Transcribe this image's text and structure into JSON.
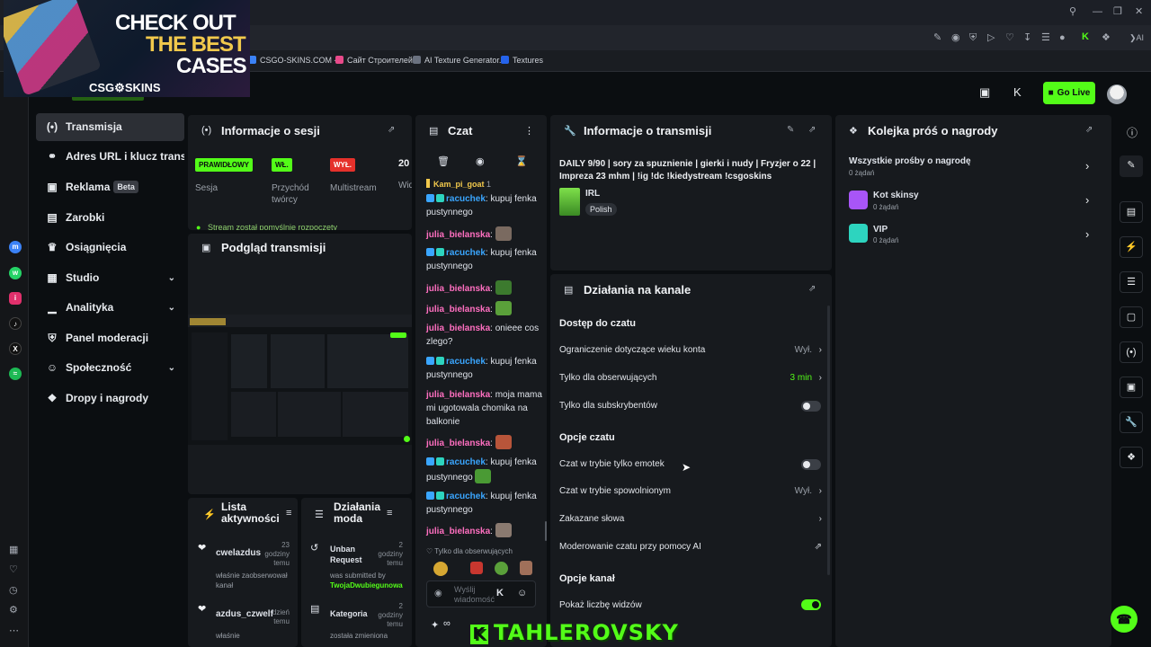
{
  "ad": {
    "line1": "CHECK OUT",
    "line2": "THE BEST",
    "line3": "CASES",
    "brand": "CSG⚙SKINS"
  },
  "bookmarks": [
    "CSGO-SKINS.COM -...",
    "Сайт Строителей",
    "AI Texture Generator...",
    "Textures"
  ],
  "browser": {
    "ai_label": "AI"
  },
  "header": {
    "go_live": "Go Live"
  },
  "nav": [
    {
      "label": "Transmisja",
      "icon": "(•)"
    },
    {
      "label": "Adres URL i klucz transmisji",
      "icon": "⚭"
    },
    {
      "label": "Reklama",
      "icon": "▣",
      "badge": "Beta"
    },
    {
      "label": "Zarobki",
      "icon": "▤"
    },
    {
      "label": "Osiągnięcia",
      "icon": "♛"
    },
    {
      "label": "Studio",
      "icon": "▦"
    },
    {
      "label": "Analityka",
      "icon": "▁"
    },
    {
      "label": "Panel moderacji",
      "icon": "⛨"
    },
    {
      "label": "Społeczność",
      "icon": "☺"
    },
    {
      "label": "Dropy i nagrody",
      "icon": "❖"
    }
  ],
  "session": {
    "title": "Informacje o sesji",
    "stats": [
      {
        "tag": "PRAWIDŁOWY",
        "label": "Sesja",
        "color": "#53fc18"
      },
      {
        "tag": "WŁ.",
        "label": "Przychód twórcy",
        "color": "#53fc18"
      },
      {
        "tag": "WYŁ.",
        "label": "Multistream",
        "color": "#e5312b"
      },
      {
        "tag": "20",
        "label": "Wid"
      }
    ],
    "notice": "Stream został pomyślnie rozpoczęty"
  },
  "preview": {
    "title": "Podgląd transmisji"
  },
  "activity": {
    "title": "Lista aktywności",
    "items": [
      {
        "user": "cwelazdus",
        "time": "23 godziny temu",
        "text": "właśnie zaobserwował kanał"
      },
      {
        "user": "azdus_czwelf",
        "time": "dzień temu",
        "text": "właśnie"
      }
    ]
  },
  "modactions": {
    "title": "Działania moda",
    "items": [
      {
        "title": "Unban Request",
        "time": "2 godziny temu",
        "text": "was submitted by",
        "user": "TwojaDwubiegunowa"
      },
      {
        "title": "Kategoria",
        "time": "2 godziny temu",
        "text": "została zmieniona"
      }
    ]
  },
  "chat": {
    "title": "Czat",
    "pinned": {
      "user": "Kam_pi_goat",
      "count": "1"
    },
    "messages": [
      {
        "user": "racuchek",
        "text": ": kupuj fenka pustynnego",
        "color": "#3aa6ff",
        "badges": true
      },
      {
        "user": "julia_bielanska",
        "text": ":",
        "color": "#ff6fc0",
        "emote": "#7a6a60"
      },
      {
        "user": "racuchek",
        "text": ": kupuj fenka pustynnego",
        "color": "#3aa6ff",
        "badges": true
      },
      {
        "user": "julia_bielanska",
        "text": ":",
        "color": "#ff6fc0",
        "emote": "#3c7a2e"
      },
      {
        "user": "julia_bielanska",
        "text": ":",
        "color": "#ff6fc0",
        "emote": "#5aa03a"
      },
      {
        "user": "julia_bielanska",
        "text": ": onieee cos zlego?",
        "color": "#ff6fc0"
      },
      {
        "user": "racuchek",
        "text": ": kupuj fenka pustynnego",
        "color": "#3aa6ff",
        "badges": true
      },
      {
        "user": "julia_bielanska",
        "text": ": moja mama mi ugotowala chomika na balkonie",
        "color": "#ff6fc0"
      },
      {
        "user": "julia_bielanska",
        "text": ":",
        "color": "#ff6fc0",
        "emote": "#b8553a"
      },
      {
        "user": "racuchek",
        "text": ": kupuj fenka pustynnego",
        "color": "#3aa6ff",
        "badges": true,
        "emote_after": "#4a9a34"
      },
      {
        "user": "racuchek",
        "text": ": kupuj fenka pustynnego",
        "color": "#3aa6ff",
        "badges": true
      },
      {
        "user": "julia_bielanska",
        "text": ":",
        "color": "#ff6fc0",
        "emote": "#8a7a70"
      }
    ],
    "followers_only": "Tylko dla obserwujących",
    "input_placeholder": "Wyślij wiadomość"
  },
  "stream_info": {
    "title": "Informacje o transmisji",
    "stream_title": "DAILY 9/90 | sory za spuznienie | gierki i nudy | Fryzjer o 22 | Impreza 23 mhm | !ig !dc !kiedystream !csgoskins",
    "category": "IRL",
    "language": "Polish"
  },
  "channel": {
    "title": "Działania na kanale",
    "chat_access": "Dostęp do czatu",
    "rows1": [
      {
        "label": "Ograniczenie dotyczące wieku konta",
        "value": "Wył."
      },
      {
        "label": "Tylko dla obserwujących",
        "value": "3 min"
      },
      {
        "label": "Tylko dla subskrybentów",
        "toggle": false
      }
    ],
    "chat_options": "Opcje czatu",
    "rows2": [
      {
        "label": "Czat w trybie tylko emotek",
        "toggle": false
      },
      {
        "label": "Czat w trybie spowolnionym",
        "value": "Wył."
      },
      {
        "label": "Zakazane słowa"
      },
      {
        "label": "Moderowanie czatu przy pomocy AI"
      }
    ],
    "channel_options": "Opcje kanał",
    "rows3": [
      {
        "label": "Pokaż liczbę widzów",
        "toggle": true
      }
    ]
  },
  "rewards": {
    "title": "Kolejka próś o nagrody",
    "all": "Wszystkie prośby o nagrodę",
    "all_count": "0 żądań",
    "items": [
      {
        "name": "Kot skinsy",
        "count": "0 żądań",
        "color": "#a855f7"
      },
      {
        "name": "VIP",
        "count": "0 żądań",
        "color": "#2dd4bf"
      }
    ]
  },
  "watermark": "TAHLEROVSKY"
}
